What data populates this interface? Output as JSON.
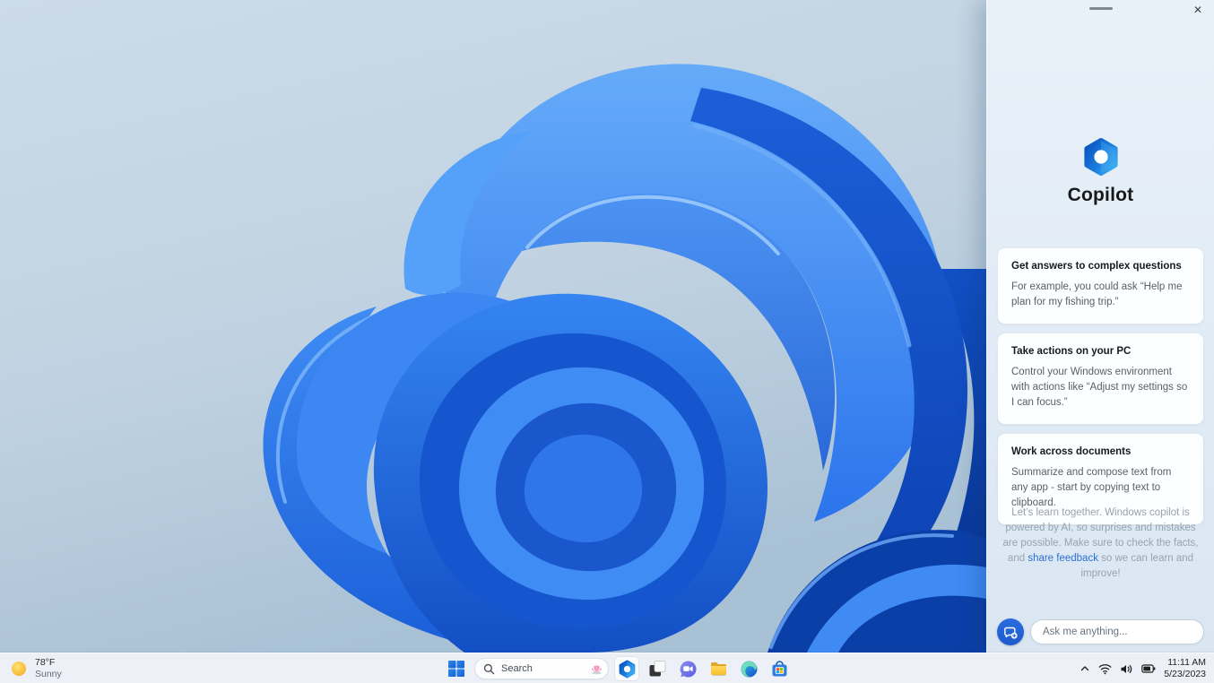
{
  "panel": {
    "title": "Copilot",
    "cards": [
      {
        "title": "Get answers to complex questions",
        "body": "For example, you could ask “Help me plan for my fishing trip.”"
      },
      {
        "title": "Take actions on your PC",
        "body": "Control your Windows environment with actions like “Adjust my settings so I can focus.”"
      },
      {
        "title": "Work across documents",
        "body": "Summarize and compose text from any app - start by copying text to clipboard."
      }
    ],
    "disclaimer": {
      "pre": "Let’s learn together. Windows copilot is powered by AI, so surprises and mistakes are possible. Make sure to check the facts, and ",
      "link": "share feedback",
      "post": " so we can learn and improve!"
    },
    "input_placeholder": "Ask me anything..."
  },
  "taskbar": {
    "weather": {
      "temperature": "78°F",
      "condition": "Sunny"
    },
    "search": {
      "placeholder": "Search"
    },
    "apps": [
      "start",
      "search",
      "copilot",
      "task-view",
      "chat",
      "file-explorer",
      "edge",
      "store"
    ],
    "copilot_active": true,
    "tray": {
      "time": "11:11 AM",
      "date": "5/23/2023"
    }
  },
  "icons": {
    "close": "✕"
  },
  "colors": {
    "accent_blue": "#1e5bcd",
    "link": "#2e6fd4",
    "panel_bg": "#e2ecf6",
    "taskbar_bg": "#edf1f7",
    "card_bg": "#ffffff",
    "wallpaper_deep_blue": "#0a3fa8",
    "wallpaper_bright_blue": "#4695f7"
  }
}
